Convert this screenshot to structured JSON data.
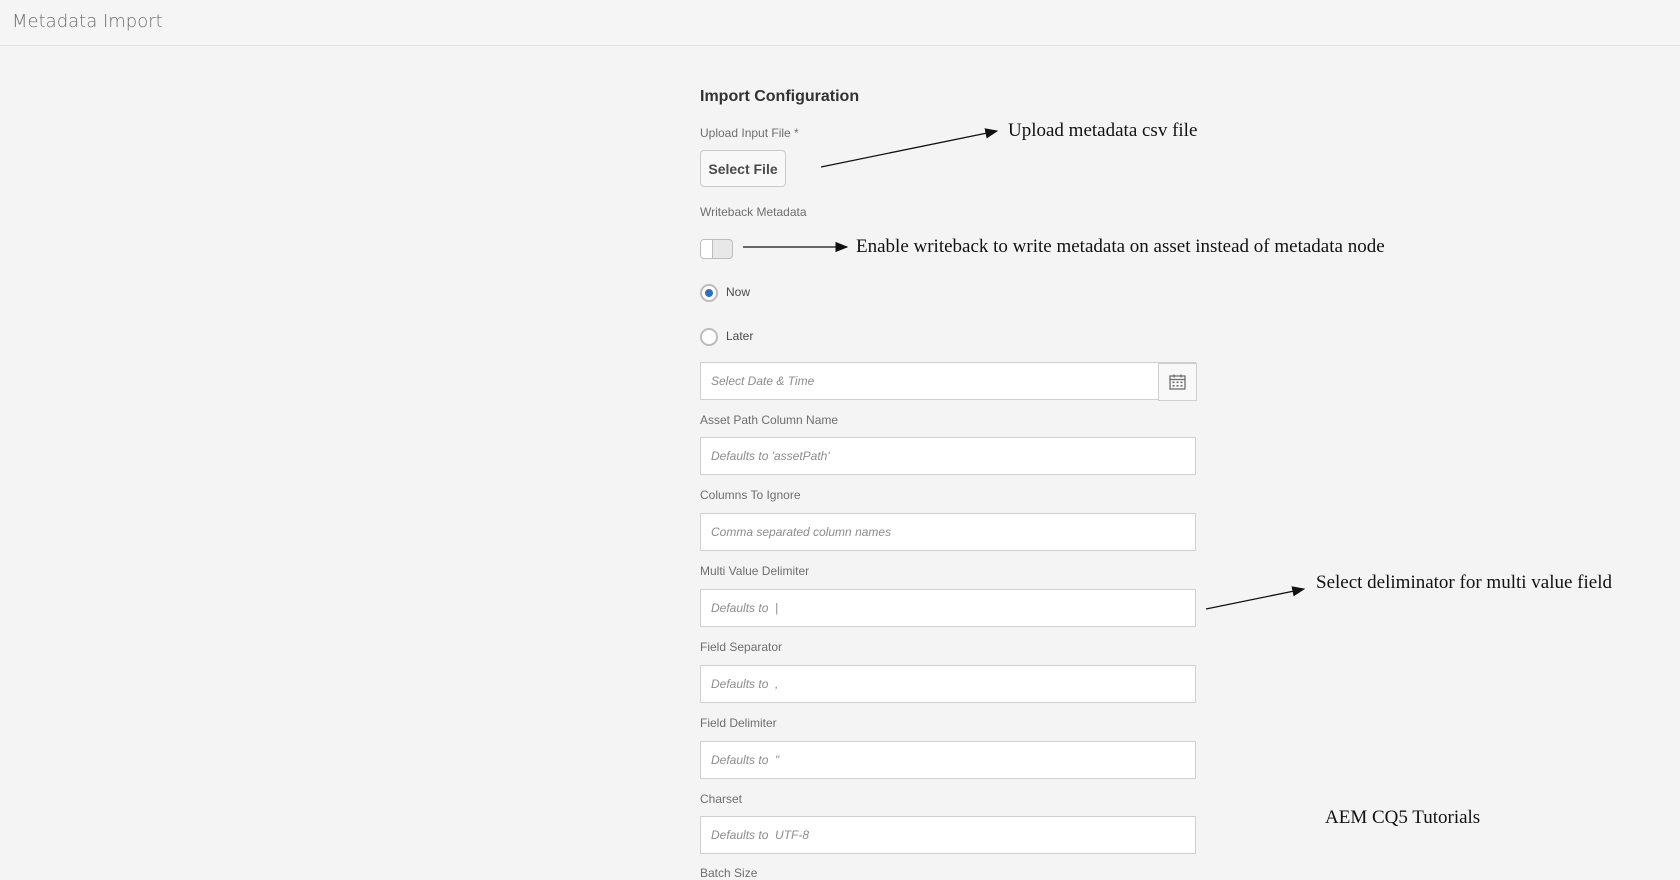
{
  "header": {
    "title": "Metadata Import"
  },
  "form": {
    "section_title": "Import Configuration",
    "upload_label": "Upload Input File *",
    "select_file_label": "Select File",
    "writeback_label": "Writeback Metadata",
    "writeback_enabled": false,
    "schedule_options": [
      {
        "label": "Now",
        "checked": true
      },
      {
        "label": "Later",
        "checked": false
      }
    ],
    "datetime_placeholder": "Select Date & Time",
    "asset_path": {
      "label": "Asset Path Column Name",
      "placeholder": "Defaults to 'assetPath'"
    },
    "columns_ignore": {
      "label": "Columns To Ignore",
      "placeholder": "Comma separated column names"
    },
    "multi_value": {
      "label": "Multi Value Delimiter",
      "placeholder": "Defaults to  |"
    },
    "field_separator": {
      "label": "Field Separator",
      "placeholder": "Defaults to  ,"
    },
    "field_delimiter": {
      "label": "Field Delimiter",
      "placeholder": "Defaults to  \""
    },
    "charset": {
      "label": "Charset",
      "placeholder": "Defaults to  UTF-8"
    },
    "batch_size_label": "Batch Size"
  },
  "annotations": {
    "upload": "Upload metadata csv file",
    "writeback": "Enable writeback to write metadata on asset instead of metadata node",
    "delimiter": "Select deliminator for multi value field",
    "watermark": "AEM CQ5 Tutorials"
  },
  "icons": {
    "calendar": "calendar-icon"
  }
}
